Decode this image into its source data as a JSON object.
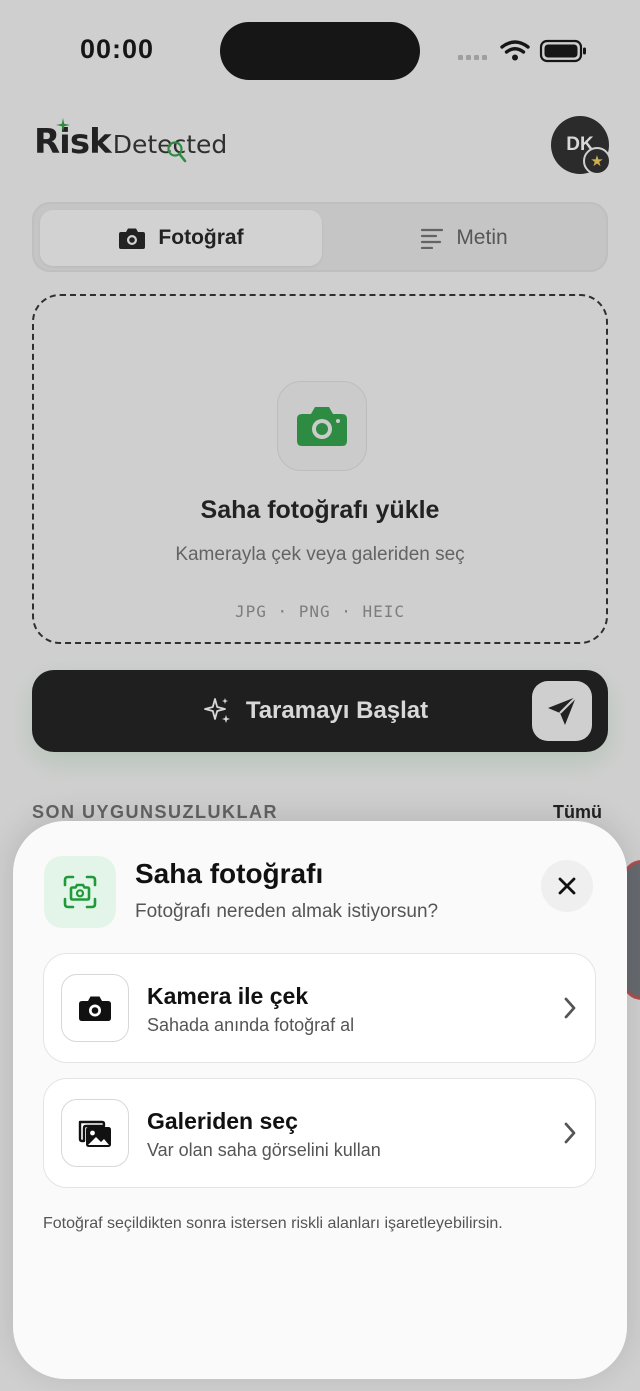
{
  "status_bar": {
    "time": "00:00"
  },
  "header": {
    "logo_primary": "Risk",
    "logo_secondary": "Detected",
    "avatar_initials": "DK",
    "avatar_badge_glyph": "★"
  },
  "tabs": [
    {
      "label": "Fotoğraf",
      "icon": "camera-icon",
      "active": true
    },
    {
      "label": "Metin",
      "icon": "text-lines-icon",
      "active": false
    }
  ],
  "upload": {
    "title": "Saha fotoğrafı yükle",
    "subtitle": "Kamerayla çek veya galeriden seç",
    "formats": "JPG · PNG · HEIC"
  },
  "scan_button": {
    "label": "Taramayı Başlat"
  },
  "recent": {
    "title": "SON UYGUNSUZLUKLAR",
    "see_all": "Tümü"
  },
  "sheet": {
    "title": "Saha fotoğrafı",
    "subtitle": "Fotoğrafı nereden almak istiyorsun?",
    "options": [
      {
        "title": "Kamera ile çek",
        "subtitle": "Sahada anında fotoğraf al",
        "icon": "camera-icon"
      },
      {
        "title": "Galeriden seç",
        "subtitle": "Var olan saha görselini kullan",
        "icon": "gallery-icon"
      }
    ],
    "note": "Fotoğraf seçildikten sonra istersen riskli alanları işaretleyebilirsin."
  },
  "colors": {
    "accent": "#1f9a3a",
    "accent_soft": "#e3f5e8",
    "button_dark": "#0d0d0d"
  }
}
